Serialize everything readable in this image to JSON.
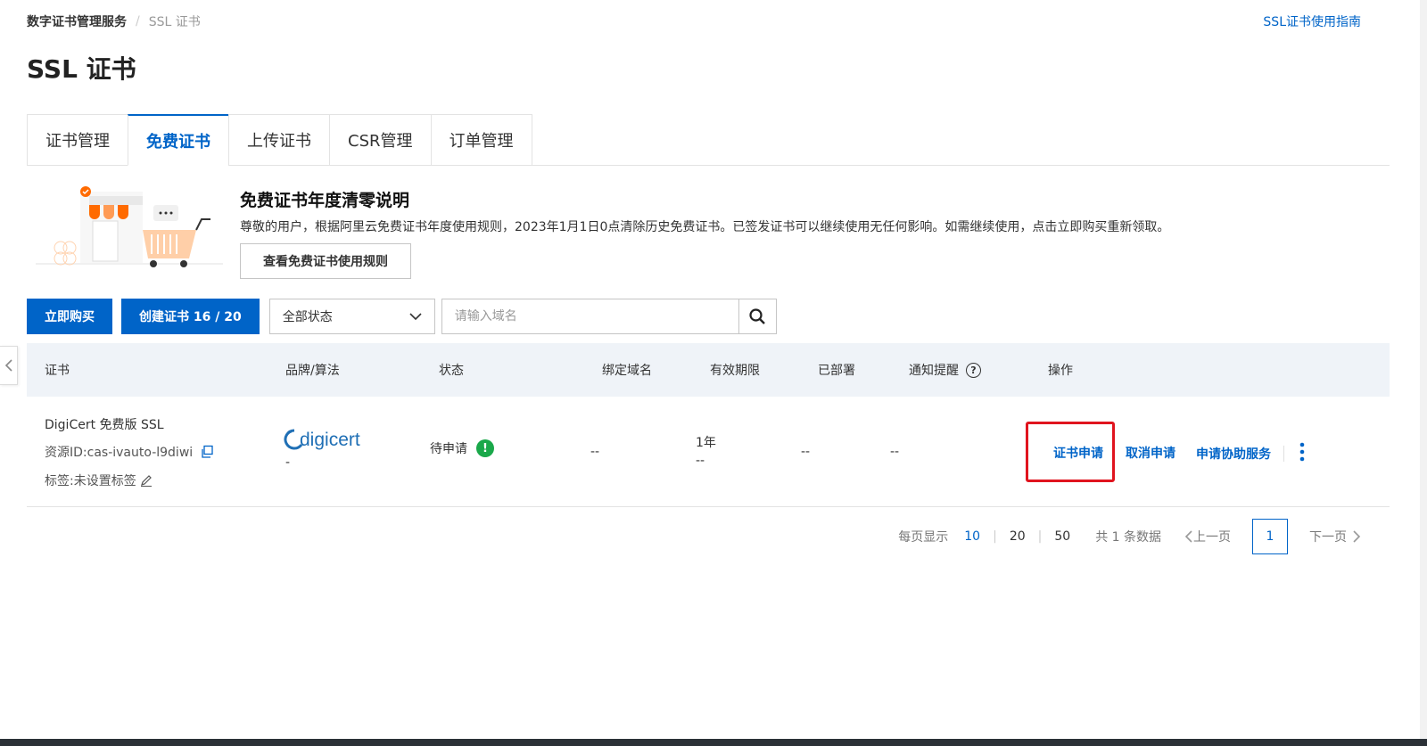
{
  "breadcrumb": {
    "root": "数字证书管理服务",
    "separator": "/",
    "current": "SSL 证书"
  },
  "guide_link": "SSL证书使用指南",
  "page_title": "SSL 证书",
  "tabs": [
    {
      "label": "证书管理",
      "active": false
    },
    {
      "label": "免费证书",
      "active": true
    },
    {
      "label": "上传证书",
      "active": false
    },
    {
      "label": "CSR管理",
      "active": false
    },
    {
      "label": "订单管理",
      "active": false
    }
  ],
  "notice": {
    "title": "免费证书年度清零说明",
    "text": "尊敬的用户，根据阿里云免费证书年度使用规则，2023年1月1日0点清除历史免费证书。已签发证书可以继续使用无任何影响。如需继续使用，点击立即购买重新领取。",
    "button": "查看免费证书使用规则"
  },
  "toolbar": {
    "buy_button": "立即购买",
    "create_button": "创建证书 16 / 20",
    "status_select": "全部状态",
    "search_placeholder": "请输入域名"
  },
  "table": {
    "headers": {
      "cert": "证书",
      "brand": "品牌/算法",
      "status": "状态",
      "domain": "绑定域名",
      "validity": "有效期限",
      "deployed": "已部署",
      "notify": "通知提醒",
      "ops": "操作"
    },
    "rows": [
      {
        "name": "DigiCert 免费版 SSL",
        "resource_id": "资源ID:cas-ivauto-l9diwi",
        "tag": "标签:未设置标签",
        "brand_logo": "digicert",
        "algorithm": "-",
        "status": "待申请",
        "domain": "--",
        "validity_period": "1年",
        "validity_date": "--",
        "deployed": "--",
        "notify": "--",
        "actions": [
          "证书申请",
          "取消申请",
          "申请协助服务"
        ]
      }
    ]
  },
  "pagination": {
    "per_page_label": "每页显示",
    "sizes": [
      "10",
      "20",
      "50"
    ],
    "selected_size": "10",
    "total": "共 1 条数据",
    "prev": "上一页",
    "current_page": "1",
    "next": "下一页"
  },
  "colors": {
    "primary": "#0064c8",
    "success": "#1aa84a",
    "highlight": "#e0141e"
  }
}
